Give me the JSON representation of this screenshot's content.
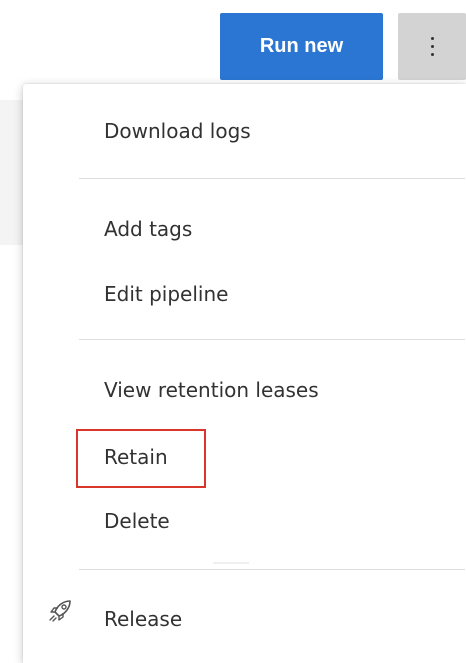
{
  "toolbar": {
    "run_new_label": "Run new",
    "more_icon": "more-vertical-icon",
    "accent_color": "#2a76d2"
  },
  "menu": {
    "items": [
      {
        "label": "Download logs"
      },
      {
        "label": "Add tags"
      },
      {
        "label": "Edit pipeline"
      },
      {
        "label": "View retention leases"
      },
      {
        "label": "Retain"
      },
      {
        "label": "Delete"
      },
      {
        "label": "Release",
        "icon": "rocket-icon"
      }
    ],
    "highlight_color": "#d9362b"
  }
}
